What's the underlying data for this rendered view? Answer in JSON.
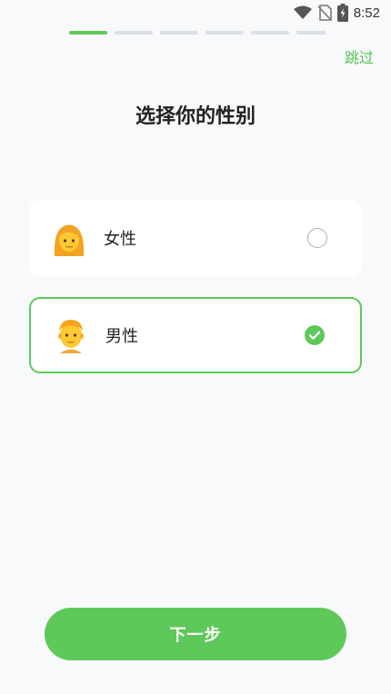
{
  "status_bar": {
    "time": "8:52",
    "icons": [
      "wifi-icon",
      "no-sim-icon",
      "battery-charging-icon"
    ]
  },
  "progress": {
    "total_steps": 6,
    "current_step": 1,
    "active_color": "#5ec95a",
    "inactive_color": "#dcdfe3"
  },
  "header": {
    "skip_label": "跳过"
  },
  "page": {
    "title": "选择你的性别"
  },
  "options": [
    {
      "label": "女性",
      "icon": "woman-emoji-icon",
      "selected": false
    },
    {
      "label": "男性",
      "icon": "man-emoji-icon",
      "selected": true
    }
  ],
  "footer": {
    "next_label": "下一步"
  },
  "colors": {
    "accent": "#5ec95a",
    "background": "#f7f9fb",
    "card": "#ffffff"
  }
}
